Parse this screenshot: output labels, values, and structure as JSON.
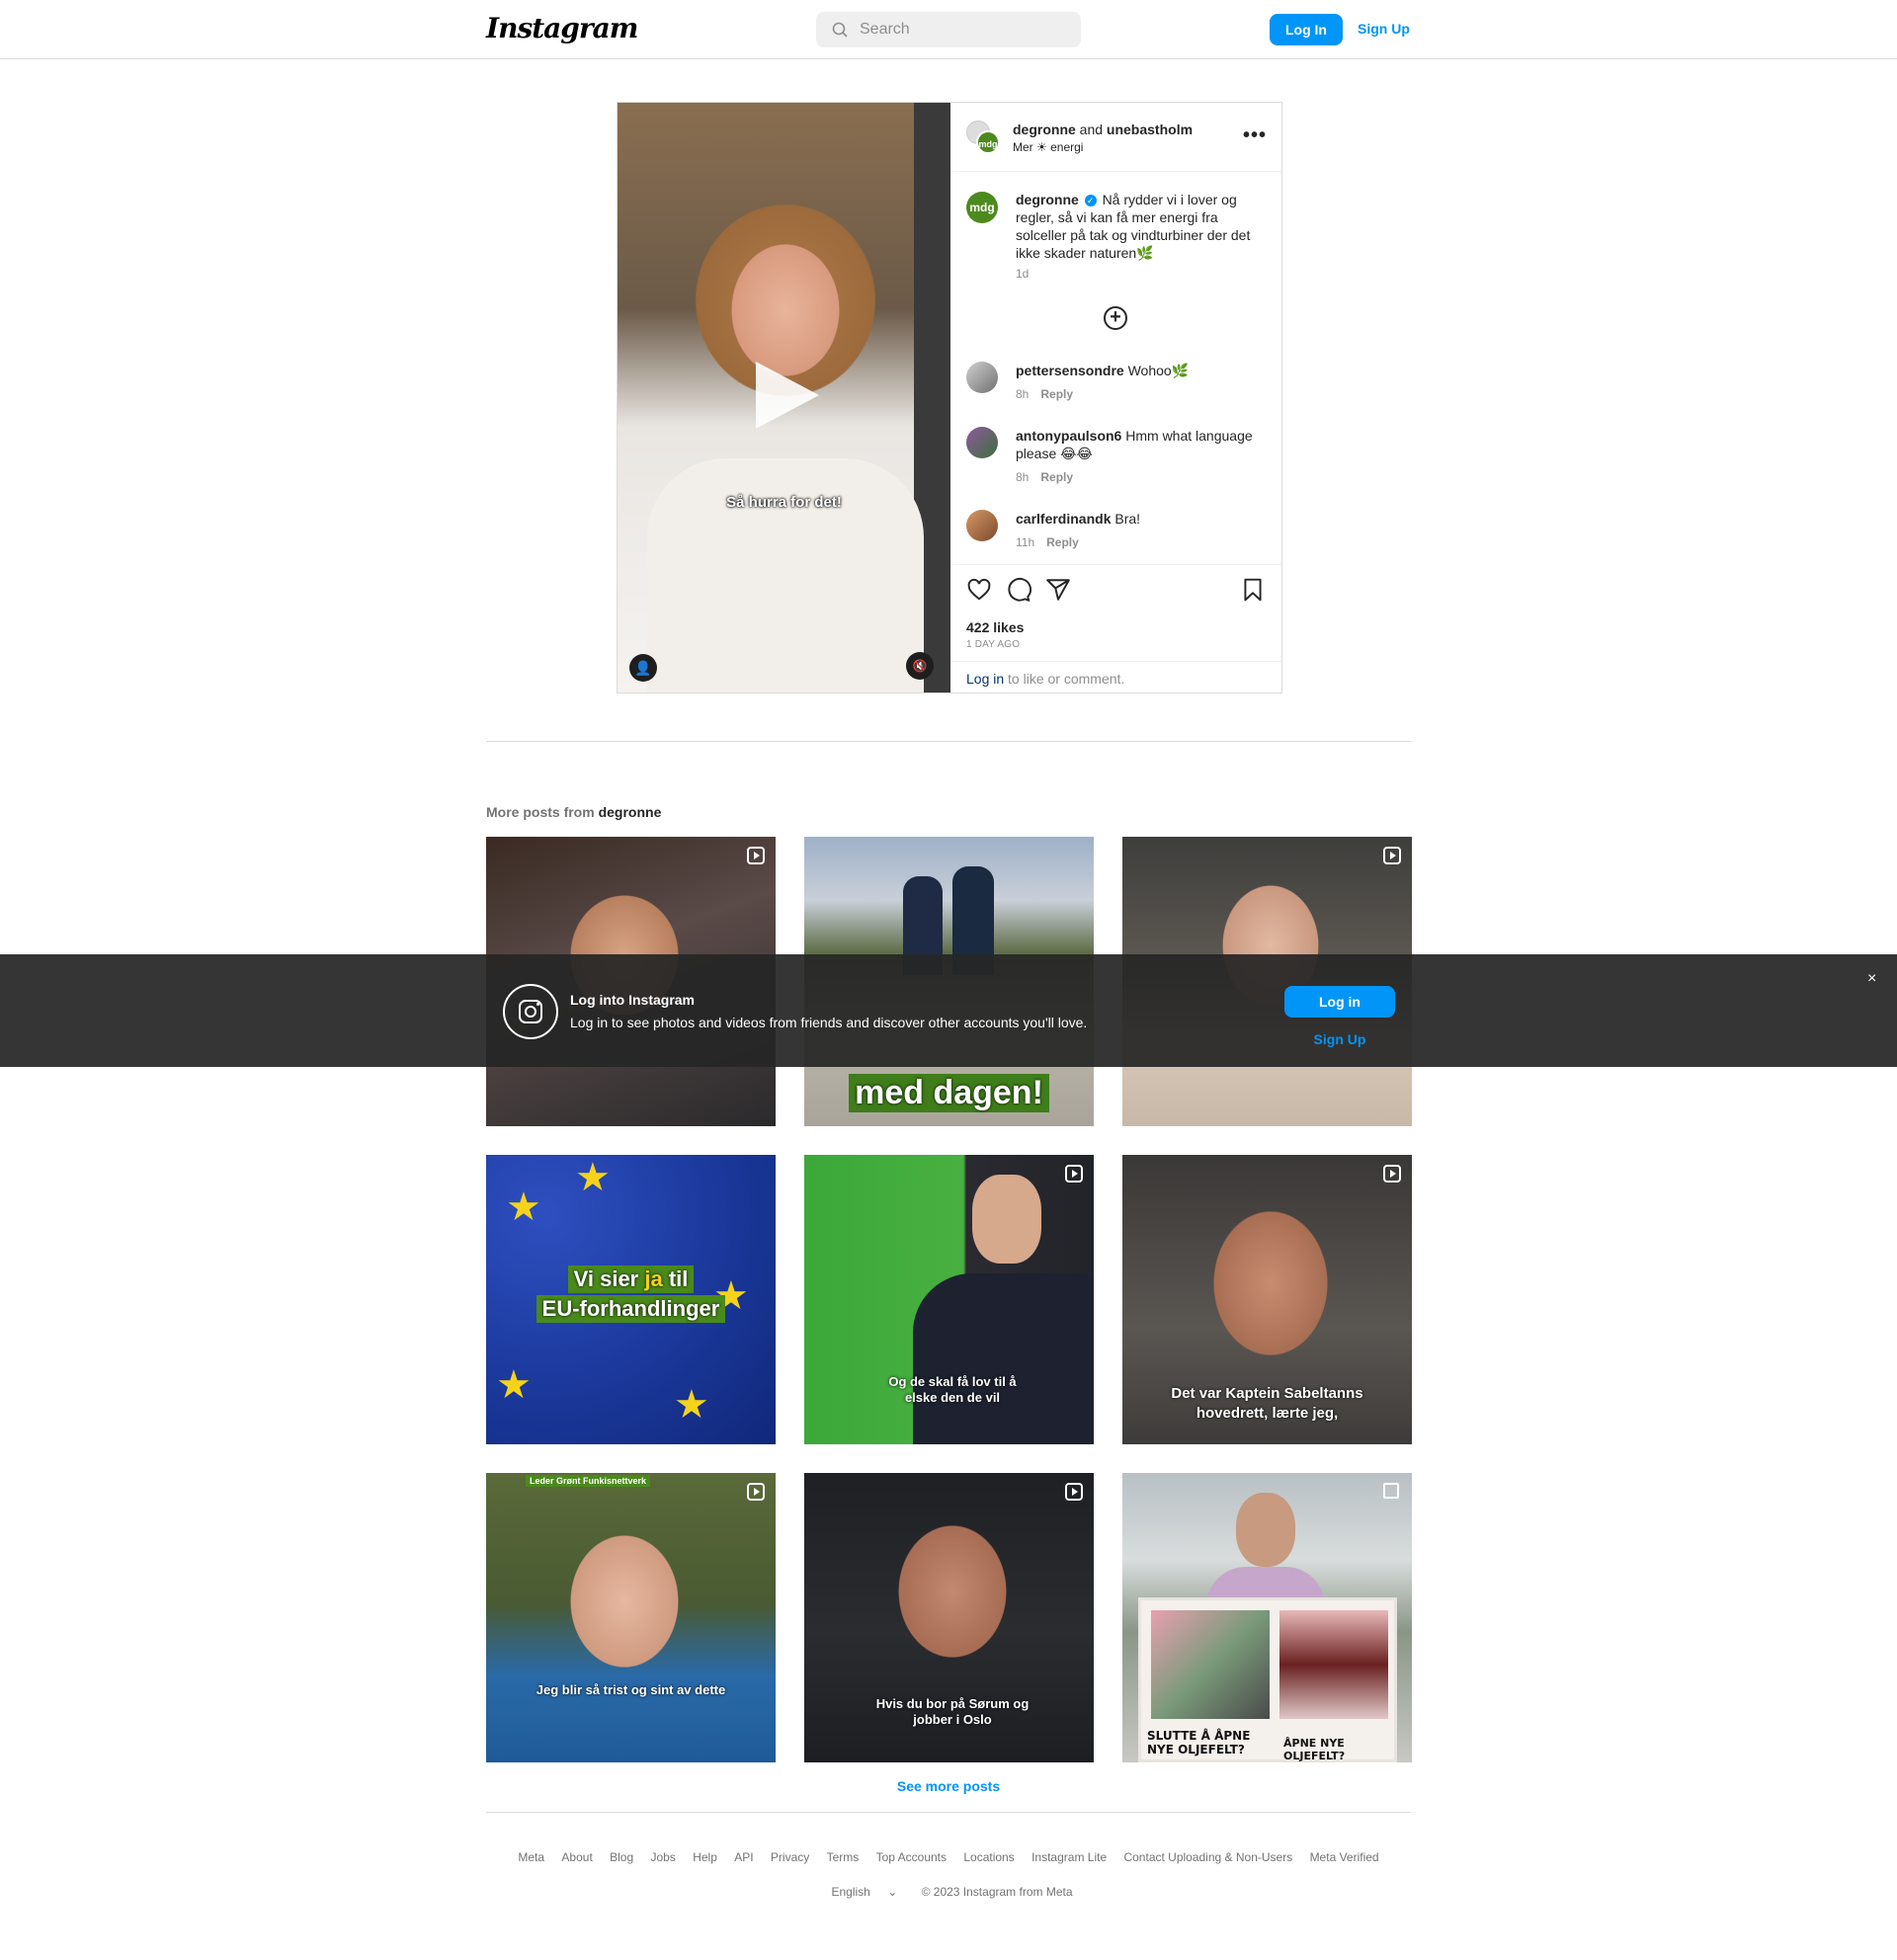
{
  "header": {
    "logo": "Instagram",
    "search_placeholder": "Search",
    "login_label": "Log In",
    "signup_label": "Sign Up"
  },
  "post": {
    "author": "degronne",
    "and_text": "and",
    "collaborator": "unebastholm",
    "subtitle": "Mer ☀ energi",
    "video_caption": "Så hurra for det!",
    "avatar_text": "mdg",
    "caption_user": "degronne",
    "caption_text": "Nå rydder vi i lover og regler, så vi kan få mer energi fra solceller på tak og vindturbiner der det ikke skader naturen🌿",
    "caption_time": "1d",
    "comments": [
      {
        "user": "pettersensondre",
        "text": "Wohoo🌿",
        "time": "8h",
        "reply": "Reply"
      },
      {
        "user": "antonypaulson6",
        "text": "Hmm what language please 😂😂",
        "time": "8h",
        "reply": "Reply"
      },
      {
        "user": "carlferdinandk",
        "text": "Bra!",
        "time": "11h",
        "reply": "Reply"
      }
    ],
    "likes": "422 likes",
    "posted_ago": "1 DAY AGO",
    "login_link": "Log in",
    "login_suffix": "to like or comment.",
    "icons": {
      "like": "heart-icon",
      "comment": "comment-icon",
      "share": "share-icon",
      "save": "bookmark-icon",
      "more": "more-icon"
    }
  },
  "more_posts": {
    "label": "More posts from",
    "user": "degronne",
    "tiles": [
      {
        "overlay": "",
        "type": "reel"
      },
      {
        "overlay": "med dagen!",
        "type": "none"
      },
      {
        "overlay": "",
        "type": "reel"
      },
      {
        "overlay_line1_a": "Vi sier ",
        "overlay_line1_b": "ja",
        "overlay_line1_c": " til",
        "overlay_line2": "EU-forhandlinger",
        "type": "none"
      },
      {
        "overlay": "Og de skal få lov til å elske den de vil",
        "type": "reel"
      },
      {
        "overlay": "Det var Kaptein Sabeltanns hovedrett, lærte jeg,",
        "type": "reel"
      },
      {
        "overlay_top": "Leder Grønt Funkisnettverk",
        "overlay": "Jeg blir så trist og sint av dette",
        "type": "reel"
      },
      {
        "overlay": "Hvis du bor på Sørum og jobber i Oslo",
        "type": "reel"
      },
      {
        "sign_left": "SLUTTE Å ÅPNE NYE OLJEFELT?",
        "sign_right": "ÅPNE NYE OLJEFELT?",
        "type": "multi"
      }
    ],
    "see_more": "See more posts"
  },
  "footer": {
    "links": [
      "Meta",
      "About",
      "Blog",
      "Jobs",
      "Help",
      "API",
      "Privacy",
      "Terms",
      "Top Accounts",
      "Locations",
      "Instagram Lite",
      "Contact Uploading & Non-Users",
      "Meta Verified"
    ],
    "language": "English",
    "copyright": "© 2023 Instagram from Meta"
  },
  "banner": {
    "title": "Log into Instagram",
    "text": "Log in to see photos and videos from friends and discover other accounts you'll love.",
    "login_label": "Log in",
    "signup_label": "Sign Up",
    "close": "×"
  },
  "colors": {
    "accent": "#0095f6",
    "brand_green": "#4d8a1e",
    "text": "#262626",
    "muted": "#8e8e8e"
  }
}
